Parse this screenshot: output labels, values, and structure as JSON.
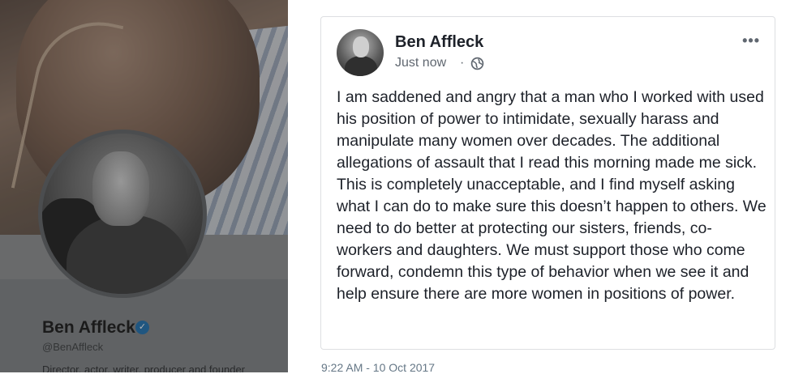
{
  "profile": {
    "name": "Ben Affleck",
    "handle": "@BenAffleck",
    "bio": "Director, actor, writer, producer and founder"
  },
  "post": {
    "author": "Ben Affleck",
    "time": "Just now",
    "separator": "·",
    "more": "•••",
    "body": "I am saddened and angry that a man who I worked with used his position of power to intimidate, sexually harass and manipulate many women over decades. The additional allegations of assault that I read this morning made me sick. This is completely unacceptable, and I find myself asking what I can do to make sure this doesn’t happen to others. We need to do better at protecting our sisters, friends, co-workers and daughters. We must support those who come forward, condemn this type of behavior when we see it and help ensure there are more women in positions of power."
  },
  "tweet": {
    "timestamp": "9:22 AM - 10 Oct 2017"
  },
  "icons": {
    "verified": "verified-badge-icon",
    "privacy": "globe-icon",
    "menu": "more-options-icon"
  },
  "colors": {
    "verified_blue": "#1d6fb0",
    "fb_text": "#1d2129",
    "fb_meta": "#606770"
  }
}
